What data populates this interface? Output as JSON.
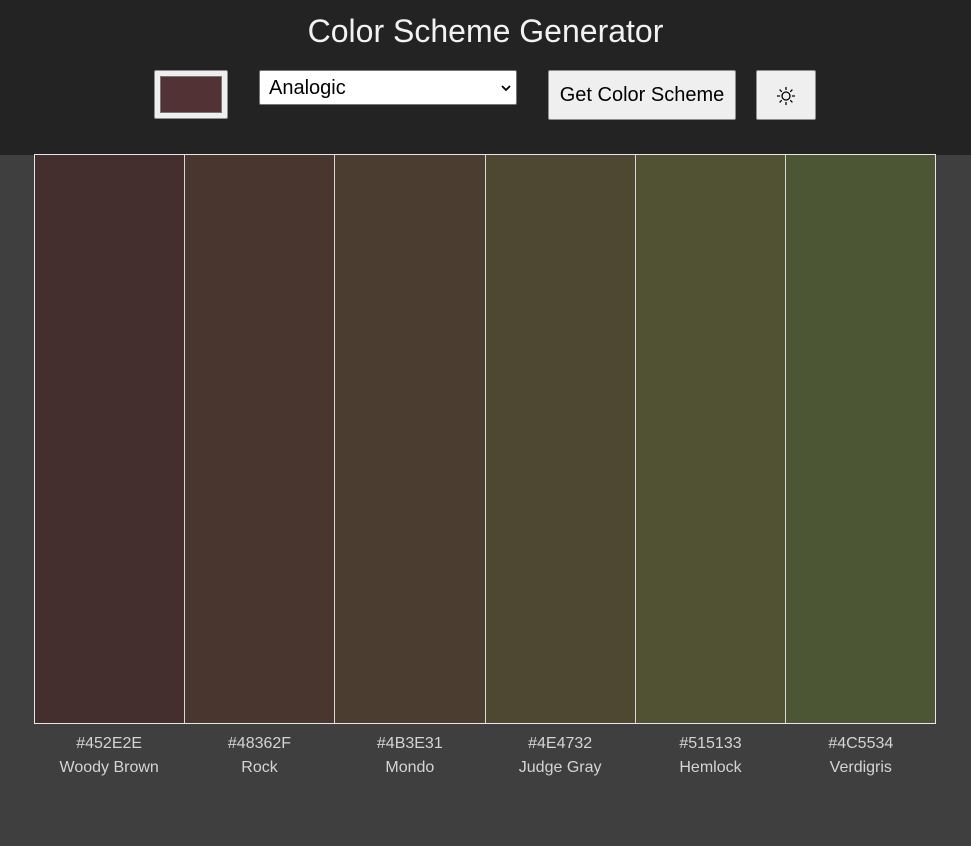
{
  "header": {
    "title": "Color Scheme Generator",
    "seed_color": "#523235",
    "mode": {
      "selected": "Analogic"
    },
    "get_button_label": "Get Color Scheme",
    "theme_icon": "sun-icon"
  },
  "palette": {
    "colors": [
      {
        "hex": "#452E2E",
        "name": "Woody Brown"
      },
      {
        "hex": "#48362F",
        "name": "Rock"
      },
      {
        "hex": "#4B3E31",
        "name": "Mondo"
      },
      {
        "hex": "#4E4732",
        "name": "Judge Gray"
      },
      {
        "hex": "#515133",
        "name": "Hemlock"
      },
      {
        "hex": "#4C5534",
        "name": "Verdigris"
      }
    ]
  },
  "theme": {
    "header_bg": "#232323",
    "page_bg": "#3f3f3f",
    "text": "#f2f2f2"
  }
}
